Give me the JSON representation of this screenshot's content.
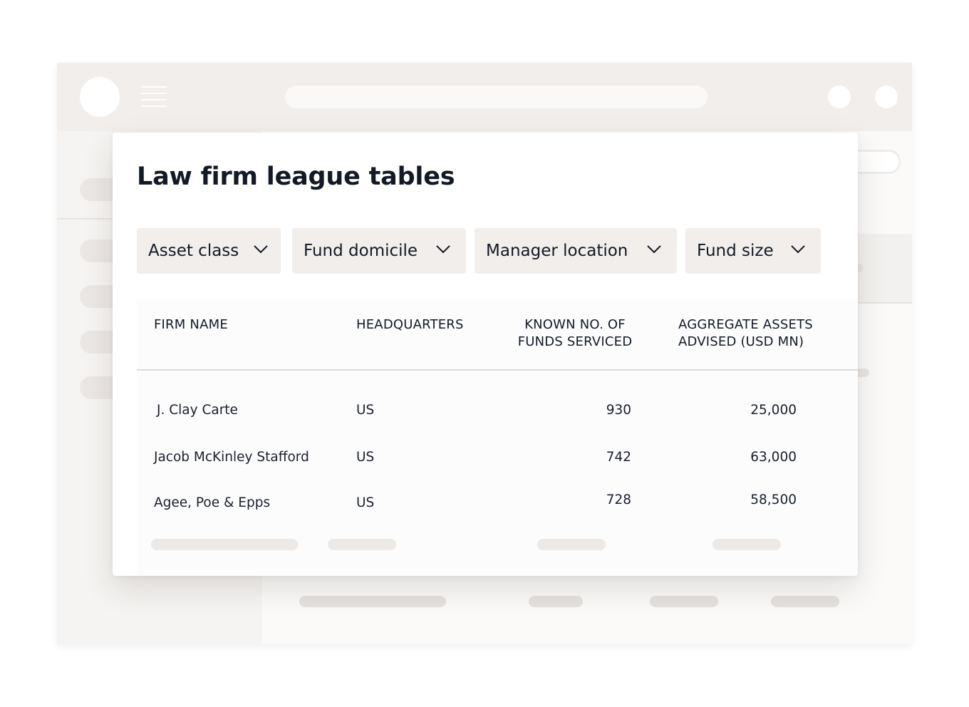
{
  "card": {
    "title": "Law firm league tables"
  },
  "filters": [
    {
      "label": "Asset class",
      "icon": "chevron-down-icon"
    },
    {
      "label": "Fund domicile",
      "icon": "chevron-down-icon"
    },
    {
      "label": "Manager location",
      "icon": "chevron-down-icon"
    },
    {
      "label": "Fund size",
      "icon": "chevron-down-icon"
    }
  ],
  "table": {
    "columns": [
      {
        "line1": "FIRM NAME",
        "line2": ""
      },
      {
        "line1": "HEADQUARTERS",
        "line2": ""
      },
      {
        "line1": "KNOWN NO. OF",
        "line2": "FUNDS SERVICED"
      },
      {
        "line1": "AGGREGATE ASSETS",
        "line2": "ADVISED (USD MN)"
      }
    ],
    "rows": [
      {
        "firm": "J. Clay Carte",
        "hq": "US",
        "funds": "930",
        "assets": "25,000"
      },
      {
        "firm": "Jacob McKinley Stafford",
        "hq": "US",
        "funds": "742",
        "assets": "63,000"
      },
      {
        "firm": "Agee, Poe & Epps",
        "hq": "US",
        "funds": "728",
        "assets": "58,500"
      }
    ]
  },
  "colors": {
    "accent_text": "#131a26",
    "filter_background": "#f1eeeb",
    "browser_bar": "#f1eeeb",
    "skeleton": "#ece9e6"
  }
}
